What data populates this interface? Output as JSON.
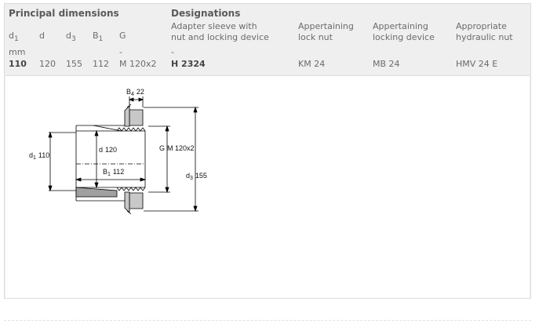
{
  "header": {
    "principal": "Principal dimensions",
    "designations": "Designations"
  },
  "columns": {
    "d1": {
      "main": "d",
      "sub": "1"
    },
    "d": "d",
    "d3": {
      "main": "d",
      "sub": "3"
    },
    "B1": {
      "main": "B",
      "sub": "1"
    },
    "G": "G",
    "sleeve": [
      "Adapter sleeve with",
      "nut and locking device"
    ],
    "lock_nut": [
      "Appertaining",
      "lock nut"
    ],
    "locking_device": [
      "Appertaining",
      "locking device"
    ],
    "hydraulic_nut": [
      "Appropriate",
      "hydraulic nut"
    ]
  },
  "units": {
    "mm": "mm",
    "g_unit": "-",
    "sleeve_unit": "-"
  },
  "row": {
    "d1": "110",
    "d": "120",
    "d3": "155",
    "B1": "112",
    "G": "M 120x2",
    "sleeve": "H 2324",
    "lock_nut": "KM 24",
    "locking_device": "MB 24",
    "hydraulic_nut": "HMV 24 E"
  },
  "drawing": {
    "B4": {
      "main": "B",
      "sub": "4",
      "value": "22"
    },
    "d1": {
      "main": "d",
      "sub": "1",
      "value": "110"
    },
    "d": {
      "main": "d",
      "value": "120"
    },
    "G": {
      "main": "G",
      "value": "M 120x2"
    },
    "d3": {
      "main": "d",
      "sub": "3",
      "value": "155"
    },
    "B1": {
      "main": "B",
      "sub": "1",
      "value": "112"
    }
  }
}
